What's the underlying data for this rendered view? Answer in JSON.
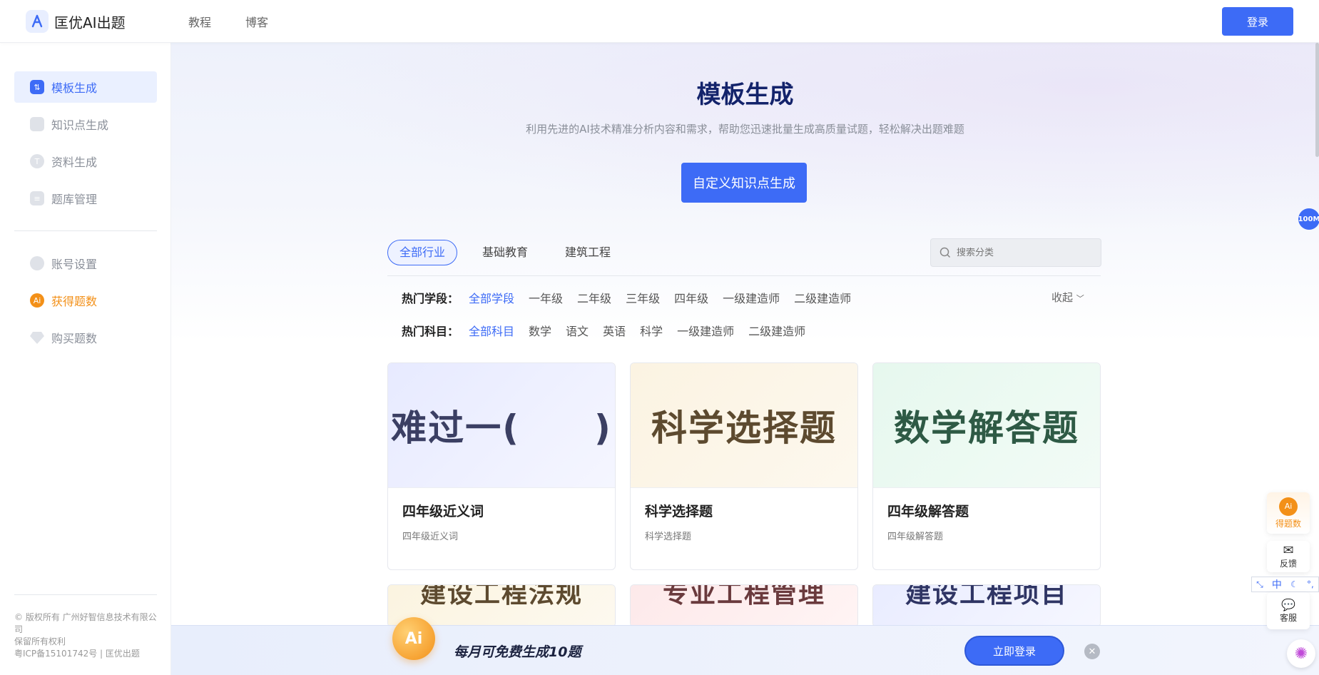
{
  "header": {
    "logo_text": "匡优AI出题",
    "nav": [
      "教程",
      "博客"
    ],
    "login_label": "登录"
  },
  "sidebar": {
    "items": [
      {
        "label": "模板生成",
        "icon": "template-icon"
      },
      {
        "label": "知识点生成",
        "icon": "knowledge-icon"
      },
      {
        "label": "资料生成",
        "icon": "document-icon"
      },
      {
        "label": "题库管理",
        "icon": "database-icon"
      },
      {
        "label": "账号设置",
        "icon": "user-icon"
      },
      {
        "label": "获得题数",
        "icon": "ai-coin-icon"
      },
      {
        "label": "购买题数",
        "icon": "diamond-icon"
      }
    ],
    "footer": {
      "copyright": "© 版权所有 广州好智信息技术有限公司",
      "rights": "保留所有权利",
      "icp": "粤ICP备15101742号 | 匡优出题"
    }
  },
  "hero": {
    "title": "模板生成",
    "subtitle": "利用先进的AI技术精准分析内容和需求，帮助您迅速批量生成高质量试题，轻松解决出题难题",
    "button": "自定义知识点生成"
  },
  "tabs": [
    "全部行业",
    "基础教育",
    "建筑工程"
  ],
  "search": {
    "placeholder": "搜索分类"
  },
  "filters": {
    "stage_label": "热门学段：",
    "stages": [
      "全部学段",
      "一年级",
      "二年级",
      "三年级",
      "四年级",
      "一级建造师",
      "二级建造师"
    ],
    "subject_label": "热门科目：",
    "subjects": [
      "全部科目",
      "数学",
      "语文",
      "英语",
      "科学",
      "一级建造师",
      "二级建造师"
    ],
    "collapse": "收起"
  },
  "cards": [
    {
      "image_text": "难过一(　　)",
      "title": "四年级近义词",
      "desc": "四年级近义词"
    },
    {
      "image_text": "科学选择题",
      "title": "科学选择题",
      "desc": "科学选择题"
    },
    {
      "image_text": "数学解答题",
      "title": "四年级解答题",
      "desc": "四年级解答题"
    },
    {
      "image_text": "建设工程法规"
    },
    {
      "image_text": "专业工程管理"
    },
    {
      "image_text": "建设工程项目"
    }
  ],
  "promo": {
    "coin": "Ai",
    "text": "每月可免费生成10题",
    "button": "立即登录"
  },
  "floating": {
    "badge": "100M",
    "points_label": "得题数",
    "feedback_label": "反馈",
    "service_label": "客服",
    "ime": [
      "中"
    ]
  },
  "colors": {
    "primary": "#3d6bf6",
    "accent_orange": "#f39018",
    "title_navy": "#13236b"
  }
}
